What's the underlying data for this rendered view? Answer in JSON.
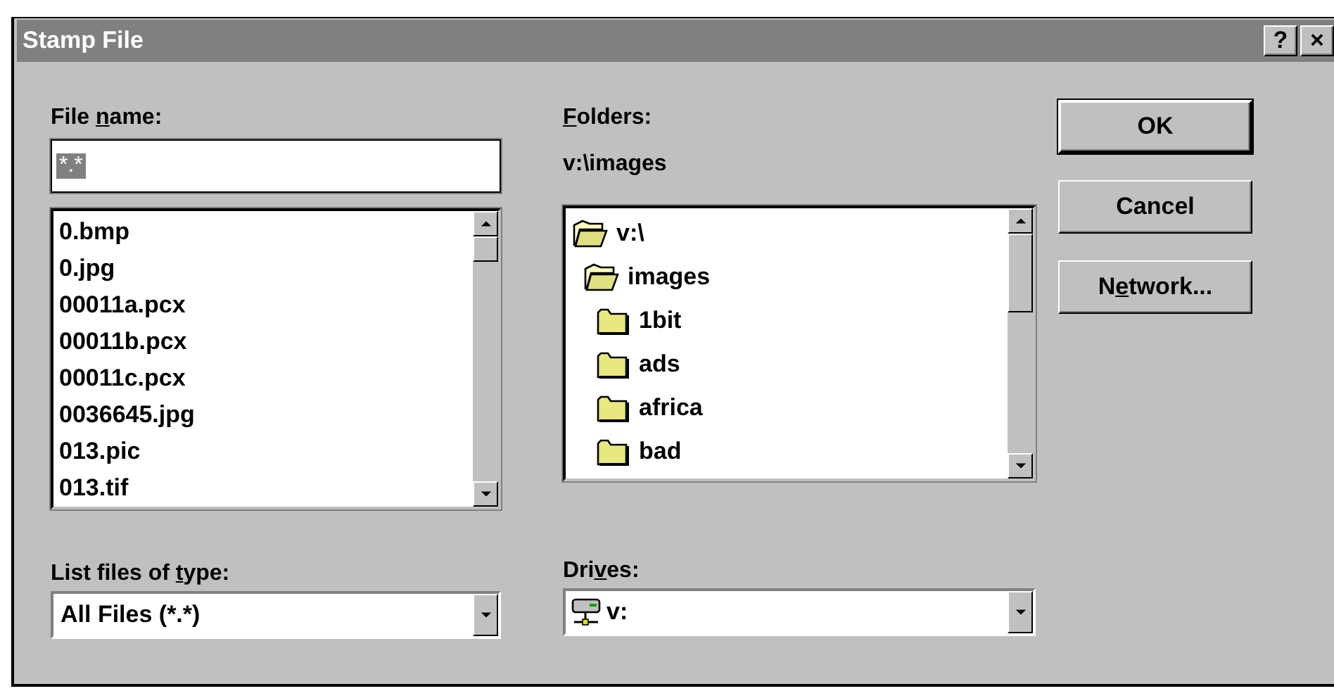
{
  "window": {
    "title": "Stamp File",
    "title_buttons": [
      "?",
      "×"
    ]
  },
  "file_name": {
    "label": {
      "pre": "File ",
      "key": "n",
      "post": "ame:"
    },
    "value": "*.*",
    "value_selected": true
  },
  "files": {
    "items": [
      "0.bmp",
      "0.jpg",
      "00011a.pcx",
      "00011b.pcx",
      "00011c.pcx",
      "0036645.jpg",
      "013.pic",
      "013.tif"
    ]
  },
  "folders": {
    "label": {
      "key": "F",
      "post": "olders:"
    },
    "path": "v:\\images",
    "tree": [
      {
        "name": "v:\\",
        "kind": "open",
        "children": [
          {
            "name": "images",
            "kind": "open",
            "children": [
              {
                "name": "1bit",
                "kind": "closed"
              },
              {
                "name": "ads",
                "kind": "closed"
              },
              {
                "name": "africa",
                "kind": "closed"
              },
              {
                "name": "bad",
                "kind": "closed"
              }
            ]
          }
        ]
      }
    ]
  },
  "file_type": {
    "label": {
      "pre": "List files of ",
      "key": "t",
      "post": "ype:"
    },
    "value": "All Files (*.*)"
  },
  "drives": {
    "label": {
      "pre": "Dri",
      "key": "v",
      "post": "es:"
    },
    "value": "v:"
  },
  "buttons": [
    {
      "post": "OK",
      "default": true
    },
    {
      "post": "Cancel",
      "default": false
    },
    {
      "pre": "N",
      "key": "e",
      "post": "twork...",
      "default": false
    }
  ]
}
